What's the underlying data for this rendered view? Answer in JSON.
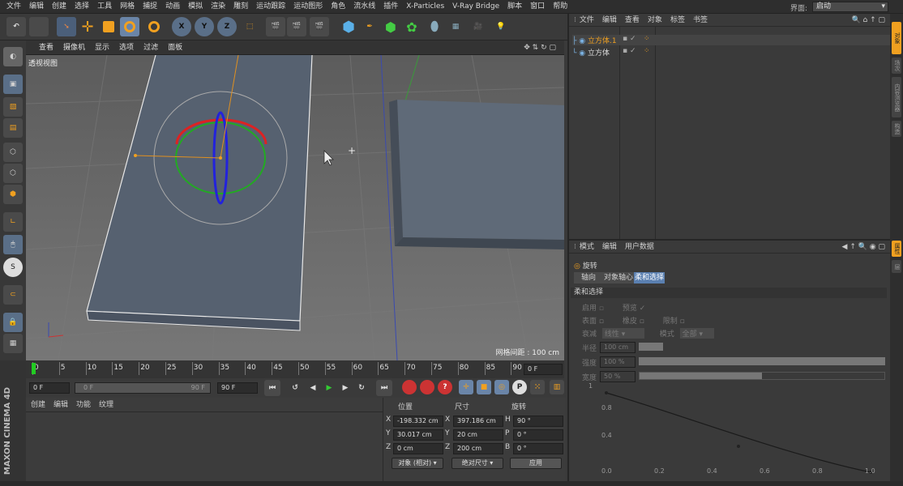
{
  "menu": [
    "文件",
    "编辑",
    "创建",
    "选择",
    "工具",
    "网格",
    "捕捉",
    "动画",
    "模拟",
    "渲染",
    "雕刻",
    "运动跟踪",
    "运动图形",
    "角色",
    "流水线",
    "插件",
    "X-Particles",
    "V-Ray Bridge",
    "脚本",
    "窗口",
    "帮助"
  ],
  "layout": {
    "label": "界面:",
    "value": "启动"
  },
  "viewport": {
    "menu": [
      "查看",
      "摄像机",
      "显示",
      "选项",
      "过滤",
      "面板"
    ],
    "view_name": "透视视图",
    "grid_spacing": "网格间距 : 100 cm"
  },
  "timeline": {
    "ticks": [
      "0",
      "5",
      "10",
      "15",
      "20",
      "25",
      "30",
      "35",
      "40",
      "45",
      "50",
      "55",
      "60",
      "65",
      "70",
      "75",
      "80",
      "85",
      "90"
    ],
    "current": "0 F"
  },
  "transport": {
    "start": "0 F",
    "range_start": "0 F",
    "range_end": "90 F",
    "end": "90 F"
  },
  "material": {
    "menu": [
      "创建",
      "编辑",
      "功能",
      "纹理"
    ]
  },
  "coords": {
    "headers": [
      "位置",
      "尺寸",
      "旋转"
    ],
    "rows": [
      {
        "axis": "X",
        "pos": "-198.332 cm",
        "saxis": "X",
        "size": "397.186 cm",
        "raxis": "H",
        "rot": "90 °"
      },
      {
        "axis": "Y",
        "pos": "30.017 cm",
        "saxis": "Y",
        "size": "20 cm",
        "raxis": "P",
        "rot": "0 °"
      },
      {
        "axis": "Z",
        "pos": "0 cm",
        "saxis": "Z",
        "size": "200 cm",
        "raxis": "B",
        "rot": "0 °"
      }
    ],
    "mode": "对象 (相对)",
    "size_mode": "绝对尺寸",
    "apply": "应用"
  },
  "objects": {
    "menu": [
      "文件",
      "编辑",
      "查看",
      "对象",
      "标签",
      "书签"
    ],
    "items": [
      "立方体.1",
      "立方体"
    ]
  },
  "attributes": {
    "menu": [
      "模式",
      "编辑",
      "用户数据"
    ],
    "tool": "旋转",
    "tabs": [
      "轴向",
      "对象轴心",
      "柔和选择"
    ],
    "section": "柔和选择",
    "enable": "启用",
    "preview": "预览",
    "surface": "表面",
    "rubber": "橡皮",
    "limit": "限制",
    "mode_label": "衰减",
    "mode_value": "线性",
    "mode2_label": "模式",
    "mode2_value": "全部",
    "radius_label": "半径",
    "radius": "100 cm",
    "strength_label": "强度",
    "strength": "100 %",
    "width_label": "宽度",
    "width": "50 %",
    "graph_y": [
      "1",
      "0.8",
      "0.4"
    ],
    "graph_x": [
      "0.0",
      "0.2",
      "0.4",
      "0.6",
      "0.8",
      "1.0"
    ]
  },
  "logo": "MAXON CINEMA 4D",
  "right_tabs": [
    "对象",
    "场次",
    "内容浏览器",
    "构造",
    "属性",
    "层"
  ]
}
